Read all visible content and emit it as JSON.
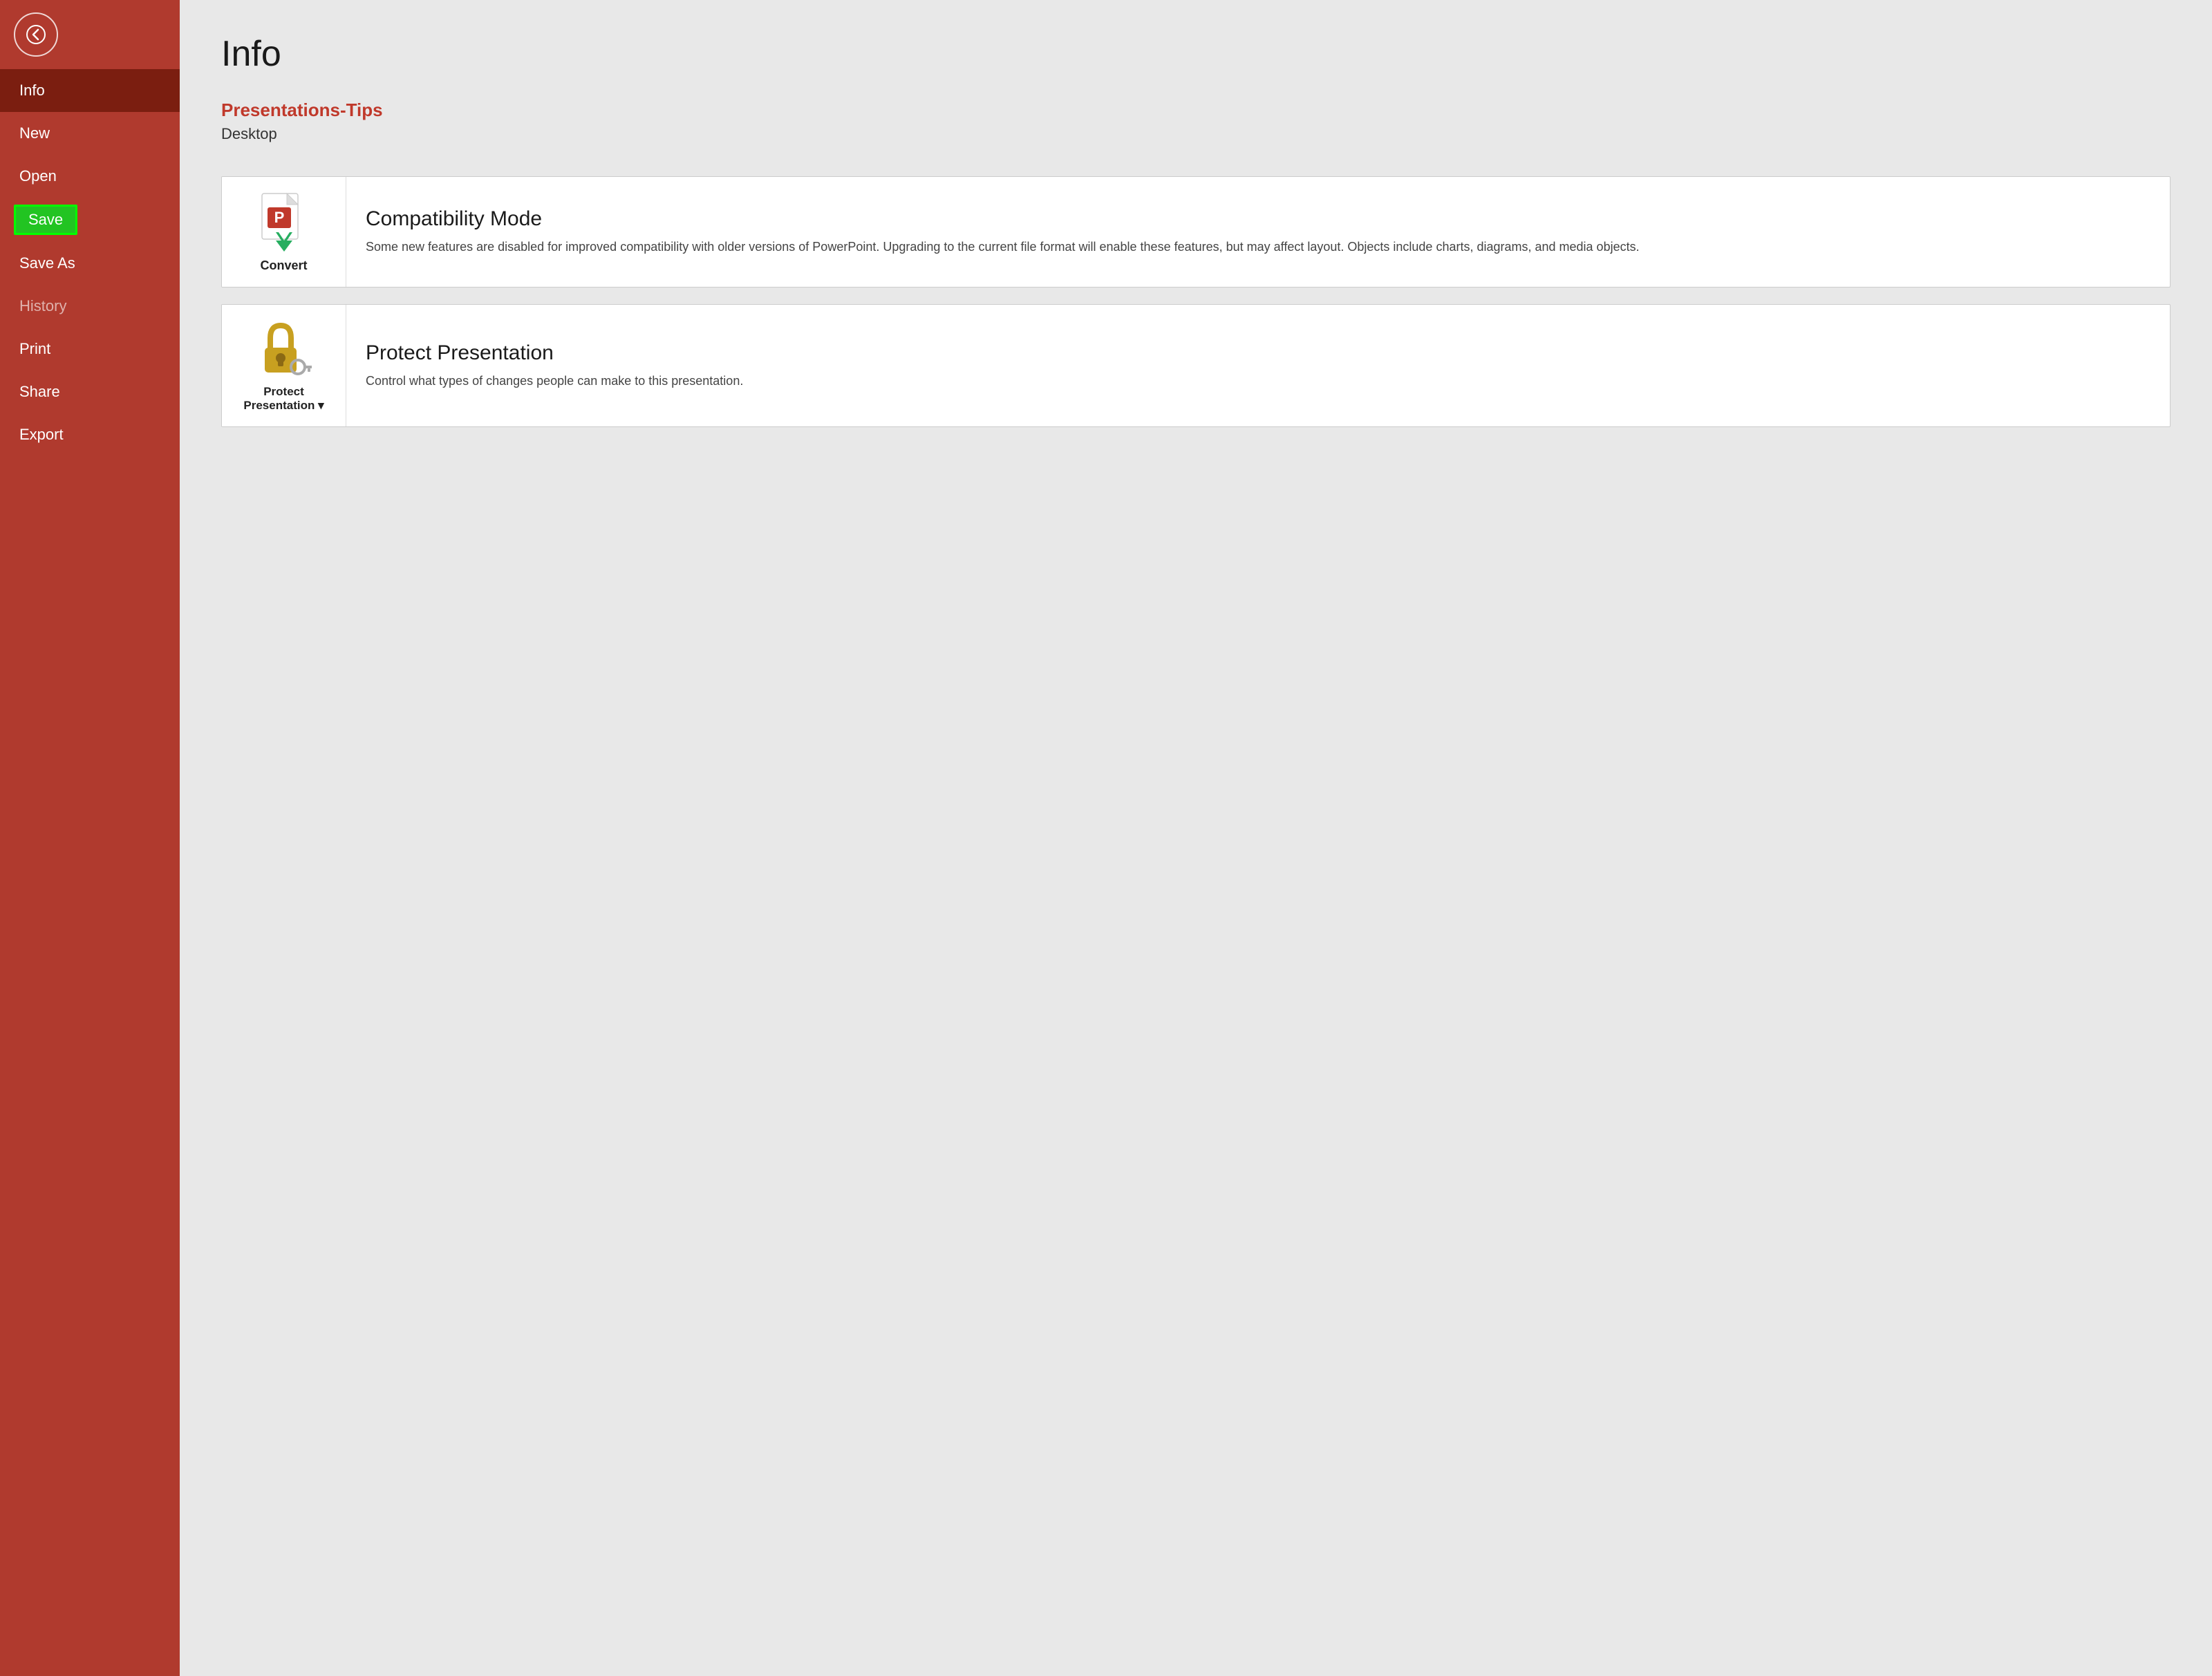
{
  "sidebar": {
    "back_button_label": "←",
    "items": [
      {
        "id": "info",
        "label": "Info",
        "state": "active"
      },
      {
        "id": "new",
        "label": "New",
        "state": "normal"
      },
      {
        "id": "open",
        "label": "Open",
        "state": "normal"
      },
      {
        "id": "save",
        "label": "Save",
        "state": "highlighted"
      },
      {
        "id": "save-as",
        "label": "Save As",
        "state": "normal"
      },
      {
        "id": "history",
        "label": "History",
        "state": "dim"
      },
      {
        "id": "print",
        "label": "Print",
        "state": "normal"
      },
      {
        "id": "share",
        "label": "Share",
        "state": "normal"
      },
      {
        "id": "export",
        "label": "Export",
        "state": "normal"
      }
    ]
  },
  "main": {
    "page_title": "Info",
    "file_name": "Presentations-Tips",
    "file_location": "Desktop",
    "cards": [
      {
        "id": "convert",
        "icon_label": "Convert",
        "title": "Compatibility Mode",
        "description": "Some new features are disabled for improved compatibility with older versions of PowerPoint. Upgrading to the current file format will enable these features, but may affect layout. Objects include charts, diagrams, and media objects."
      },
      {
        "id": "protect",
        "icon_label": "Protect\nPresentation",
        "title": "Protect Presentation",
        "description": "Control what types of changes people can make to this presentation."
      }
    ]
  },
  "colors": {
    "sidebar_bg": "#b03a2e",
    "sidebar_active": "#7b1e10",
    "accent_red": "#c0392b",
    "highlight_green": "#22c422",
    "main_bg": "#e8e8e8"
  }
}
